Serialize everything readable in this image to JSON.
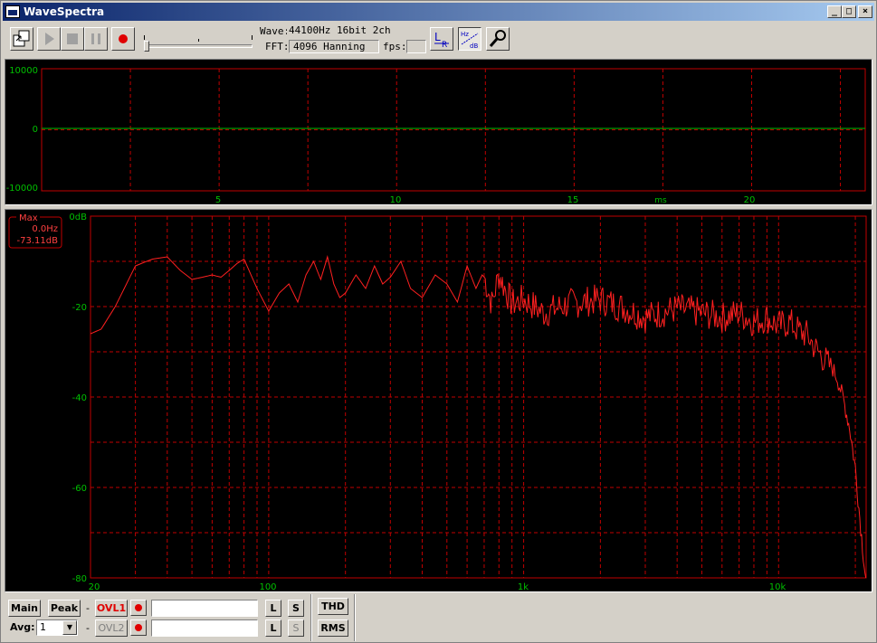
{
  "window": {
    "title": "WaveSpectra"
  },
  "titlebar_buttons": {
    "minimize": "_",
    "maximize": "□",
    "close": "×"
  },
  "info": {
    "wave_label": "Wave:",
    "wave_value": "44100Hz 16bit 2ch",
    "fft_label": "FFT:",
    "fft_value": "4096 Hanning",
    "fps_label": "fps:",
    "fps_value": ""
  },
  "toolbar": {
    "icons": [
      "open-icon",
      "play-icon",
      "stop-icon",
      "pause-icon",
      "record-icon",
      "lr-channel-icon",
      "hz-db-scale-icon",
      "settings-wrench-icon"
    ],
    "lr_label_l": "L",
    "lr_label_r": "R",
    "hzdb_label_hz": "Hz",
    "hzdb_label_db": "dB",
    "slider_level": 0.0
  },
  "waveform": {
    "y_ticks": [
      "10000",
      "0",
      "-10000"
    ],
    "x_ticks": [
      "5",
      "10",
      "15",
      "20"
    ],
    "x_unit": "ms",
    "line_color": "#00c000",
    "grid_color": "#c00000"
  },
  "spectrum": {
    "y_ticks": [
      "0dB",
      "-20",
      "-40",
      "-60",
      "-80"
    ],
    "x_ticks": [
      "20",
      "100",
      "1k",
      "10k"
    ],
    "readout": {
      "label": "Max",
      "freq": "0.0Hz",
      "level": "-73.11dB"
    },
    "line_color": "#ff2020",
    "grid_color": "#c00000"
  },
  "chart_data": [
    {
      "type": "line",
      "series": [
        {
          "values_ms": [
            0,
            23.2
          ],
          "values": [
            0,
            0
          ]
        }
      ],
      "xlabel": "ms",
      "xlim": [
        0,
        23.2
      ],
      "ylim": [
        -10000,
        10000
      ],
      "grid": true
    },
    {
      "type": "line",
      "xscale": "log",
      "xlim": [
        20,
        22050
      ],
      "ylim": [
        -80,
        0
      ],
      "grid": true,
      "series": [
        {
          "x": [
            20,
            22,
            25,
            30,
            35,
            40,
            45,
            50,
            55,
            60,
            65,
            70,
            75,
            80,
            90,
            100,
            110,
            120,
            130,
            140,
            150,
            160,
            170,
            180,
            190,
            200,
            220,
            240,
            260,
            280,
            300,
            330,
            360,
            400,
            450,
            500,
            550,
            600,
            650,
            700,
            750,
            800,
            850,
            900,
            1000,
            1200,
            1500,
            2000,
            2500,
            3000,
            4000,
            5000,
            6000,
            7000,
            8000,
            9000,
            10000,
            11000,
            12000,
            13000,
            14000,
            15000,
            16000,
            17000,
            18000,
            19000,
            20000,
            21000,
            22000
          ],
          "values": [
            -26,
            -25,
            -20,
            -11,
            -9.5,
            -9,
            -12,
            -14,
            -13.5,
            -13,
            -13.5,
            -12,
            -10.5,
            -9.5,
            -16,
            -21,
            -17,
            -15,
            -19,
            -13,
            -10,
            -14,
            -9,
            -15,
            -18,
            -17,
            -13,
            -16,
            -11,
            -15,
            -13.5,
            -10,
            -16,
            -18,
            -13,
            -15,
            -19,
            -11,
            -16,
            -12,
            -18,
            -11.5,
            -15,
            -18,
            -17,
            -20,
            -18,
            -17,
            -19,
            -21,
            -19,
            -20,
            -21,
            -20,
            -22,
            -21,
            -23,
            -22,
            -24,
            -25,
            -28,
            -30,
            -32,
            -35,
            -40,
            -46,
            -55,
            -68,
            -80
          ]
        }
      ]
    }
  ]
}
